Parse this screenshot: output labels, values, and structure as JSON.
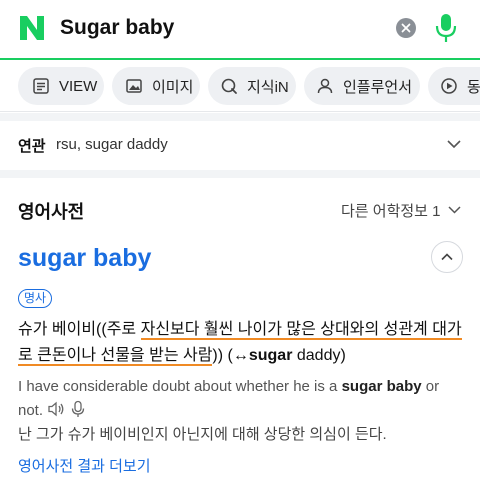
{
  "search": {
    "logo": "N",
    "query": "Sugar baby",
    "icons": {
      "clear": "clear-icon",
      "mic": "mic-icon"
    },
    "colors": {
      "brand": "#19ce60",
      "link": "#1a6de0",
      "highlight": "#f08a24"
    }
  },
  "tabs": [
    {
      "label": "VIEW",
      "icon": "view-icon"
    },
    {
      "label": "이미지",
      "icon": "image-icon"
    },
    {
      "label": "지식iN",
      "icon": "knowledge-icon"
    },
    {
      "label": "인플루언서",
      "icon": "person-icon"
    },
    {
      "label": "동영",
      "icon": "video-icon"
    }
  ],
  "related": {
    "label": "연관",
    "terms": "rsu, sugar daddy"
  },
  "dictionary": {
    "title": "영어사전",
    "source": "다른 어학정보 1",
    "headword": "sugar baby",
    "pos": "명사",
    "meaning": {
      "prefix": "슈가 베이비((주로 ",
      "underlined_1": "자신보다 훨씬 나이가 많은 상대와의 성관계 대가",
      "underlined_2": "로 큰돈이나 선물을 받는 사람",
      "suffix_1": ")) (↔",
      "bold": "sugar",
      "suffix_2": " daddy)"
    },
    "example_en": {
      "before": "I have considerable doubt about whether he is a ",
      "bold": "sugar baby",
      "after": " or not."
    },
    "example_ko": "난 그가 슈가 베이비인지 아닌지에 대해 상당한 의심이 든다.",
    "more_link": "영어사전 결과 더보기"
  }
}
